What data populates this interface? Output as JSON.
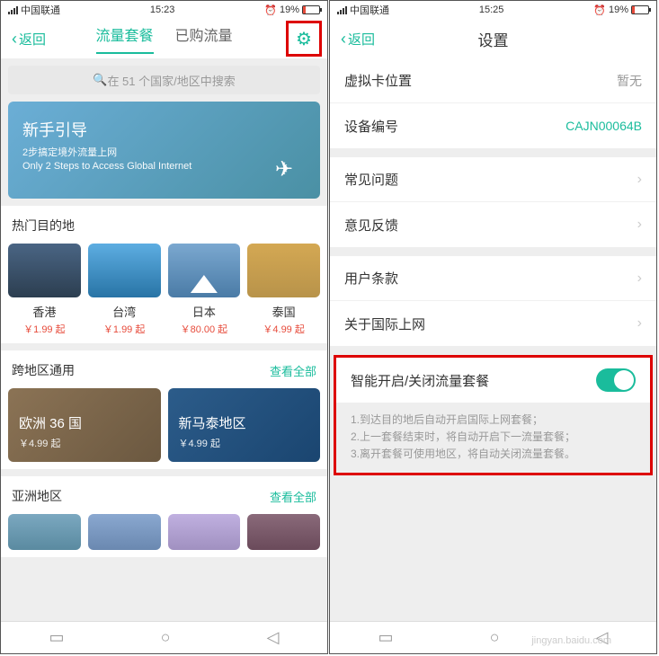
{
  "left": {
    "status": {
      "carrier": "中国联通",
      "time": "15:23",
      "battery": "19%"
    },
    "nav": {
      "back": "返回",
      "tab1": "流量套餐",
      "tab2": "已购流量"
    },
    "search": {
      "placeholder": "在 51 个国家/地区中搜索"
    },
    "banner": {
      "title": "新手引导",
      "sub1": "2步搞定境外流量上网",
      "sub2": "Only 2 Steps to Access Global Internet"
    },
    "hotdest": {
      "title": "热门目的地",
      "items": [
        {
          "name": "香港",
          "price": "￥1.99 起"
        },
        {
          "name": "台湾",
          "price": "￥1.99 起"
        },
        {
          "name": "日本",
          "price": "￥80.00 起"
        },
        {
          "name": "泰国",
          "price": "￥4.99 起"
        }
      ]
    },
    "cross": {
      "title": "跨地区通用",
      "viewall": "查看全部",
      "items": [
        {
          "name": "欧洲 36 国",
          "price": "￥4.99 起"
        },
        {
          "name": "新马泰地区",
          "price": "￥4.99 起"
        }
      ]
    },
    "asia": {
      "title": "亚洲地区",
      "viewall": "查看全部"
    }
  },
  "right": {
    "status": {
      "carrier": "中国联通",
      "time": "15:25",
      "battery": "19%"
    },
    "nav": {
      "back": "返回",
      "title": "设置"
    },
    "rows": {
      "virtual_card": {
        "label": "虚拟卡位置",
        "value": "暂无"
      },
      "device_id": {
        "label": "设备编号",
        "value": "CAJN00064B"
      },
      "faq": {
        "label": "常见问题"
      },
      "feedback": {
        "label": "意见反馈"
      },
      "terms": {
        "label": "用户条款"
      },
      "about": {
        "label": "关于国际上网"
      }
    },
    "toggle": {
      "label": "智能开启/关闭流量套餐",
      "desc1": "1.到达目的地后自动开启国际上网套餐；",
      "desc2": "2.上一套餐结束时，将自动开启下一流量套餐；",
      "desc3": "3.离开套餐可使用地区，将自动关闭流量套餐。"
    }
  },
  "watermark": "jingyan.baidu.com"
}
